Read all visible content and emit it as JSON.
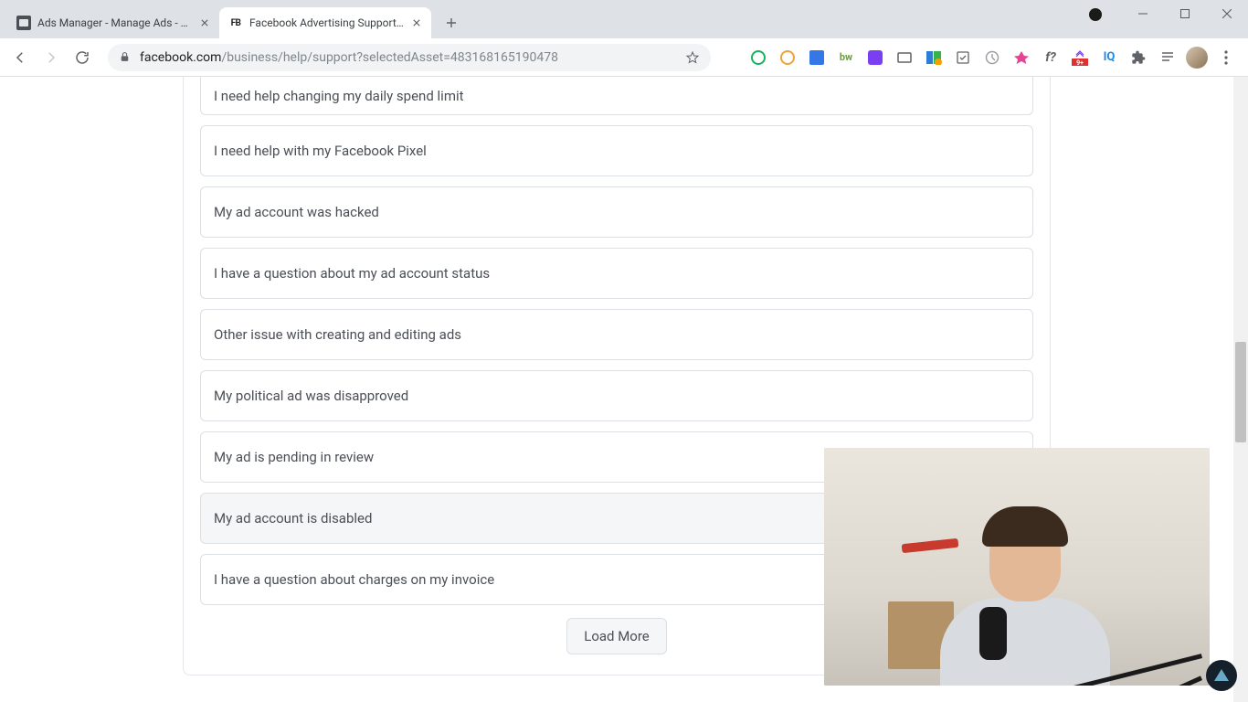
{
  "browser": {
    "tabs": [
      {
        "title": "Ads Manager - Manage Ads - Ca",
        "active": false
      },
      {
        "title": "Facebook Advertising Support | F",
        "active": true
      }
    ],
    "url_host": "facebook.com",
    "url_path": "/business/help/support?selectedAsset=483168165190478"
  },
  "issues": [
    "I need help changing my daily spend limit",
    "I need help with my Facebook Pixel",
    "My ad account was hacked",
    "I have a question about my ad account status",
    "Other issue with creating and editing ads",
    "My political ad was disapproved",
    "My ad is pending in review",
    "My ad account is disabled",
    "I have a question about charges on my invoice"
  ],
  "hovered_index": 7,
  "load_more_label": "Load More"
}
